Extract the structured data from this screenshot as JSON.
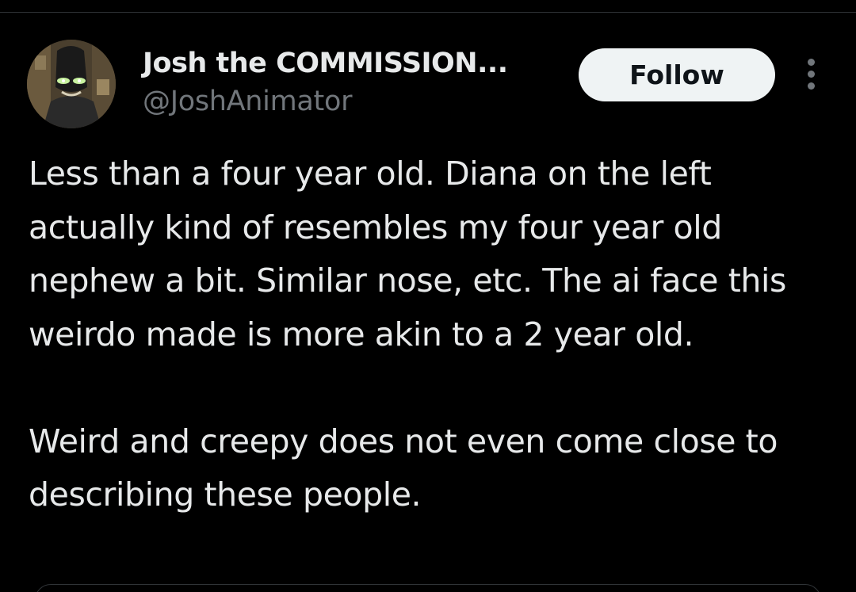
{
  "tweet": {
    "author": {
      "display_name": "Josh the COMMISSION...",
      "handle": "@JoshAnimator",
      "avatar_icon": "avatar-image"
    },
    "follow_label": "Follow",
    "more_icon": "more-options-icon",
    "paragraph_1": "Less than a four year old. Diana on the left actually kind of resembles my four year old nephew a bit. Similar nose, etc. The ai face this weirdo made is more akin to a 2 year old.",
    "paragraph_2": "Weird and creepy does not even come close to describing these people."
  },
  "colors": {
    "background": "#000000",
    "primary_text": "#e7e9ea",
    "secondary_text": "#71767b",
    "follow_bg": "#eff3f4",
    "follow_text": "#0f1419",
    "divider": "#2f3336"
  }
}
